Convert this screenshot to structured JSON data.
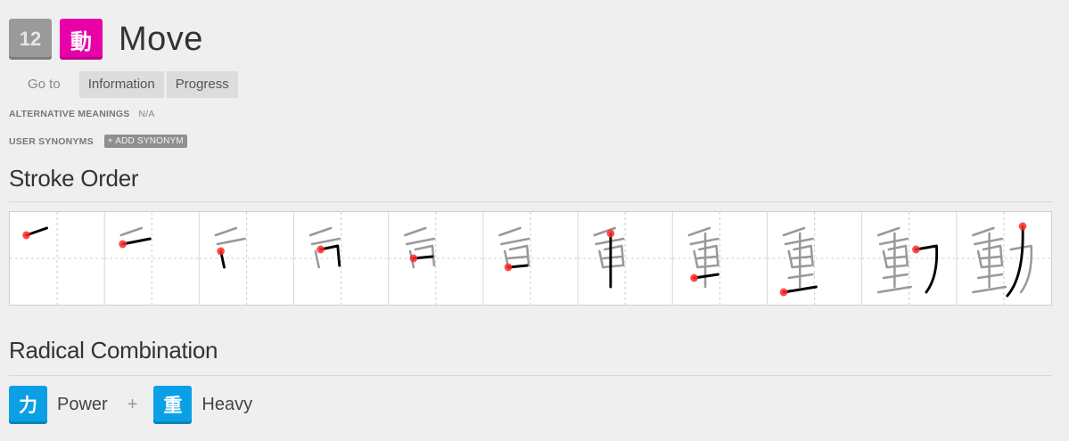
{
  "header": {
    "level": "12",
    "kanji": "動",
    "meaning": "Move",
    "level_color": "#9a9a9a",
    "kanji_color": "#e800a8"
  },
  "nav": {
    "goto_label": "Go to",
    "tabs": [
      {
        "label": "Information"
      },
      {
        "label": "Progress"
      }
    ]
  },
  "alternative_meanings": {
    "label": "ALTERNATIVE MEANINGS",
    "value": "N/A"
  },
  "user_synonyms": {
    "label": "USER SYNONYMS",
    "button": "+ ADD SYNONYM"
  },
  "stroke_order": {
    "title": "Stroke Order",
    "frame_count": 11
  },
  "radical_combination": {
    "title": "Radical Combination",
    "plus": "+",
    "radical_color": "#0ba0e6",
    "radicals": [
      {
        "char": "力",
        "name": "Power"
      },
      {
        "char": "重",
        "name": "Heavy"
      }
    ]
  }
}
